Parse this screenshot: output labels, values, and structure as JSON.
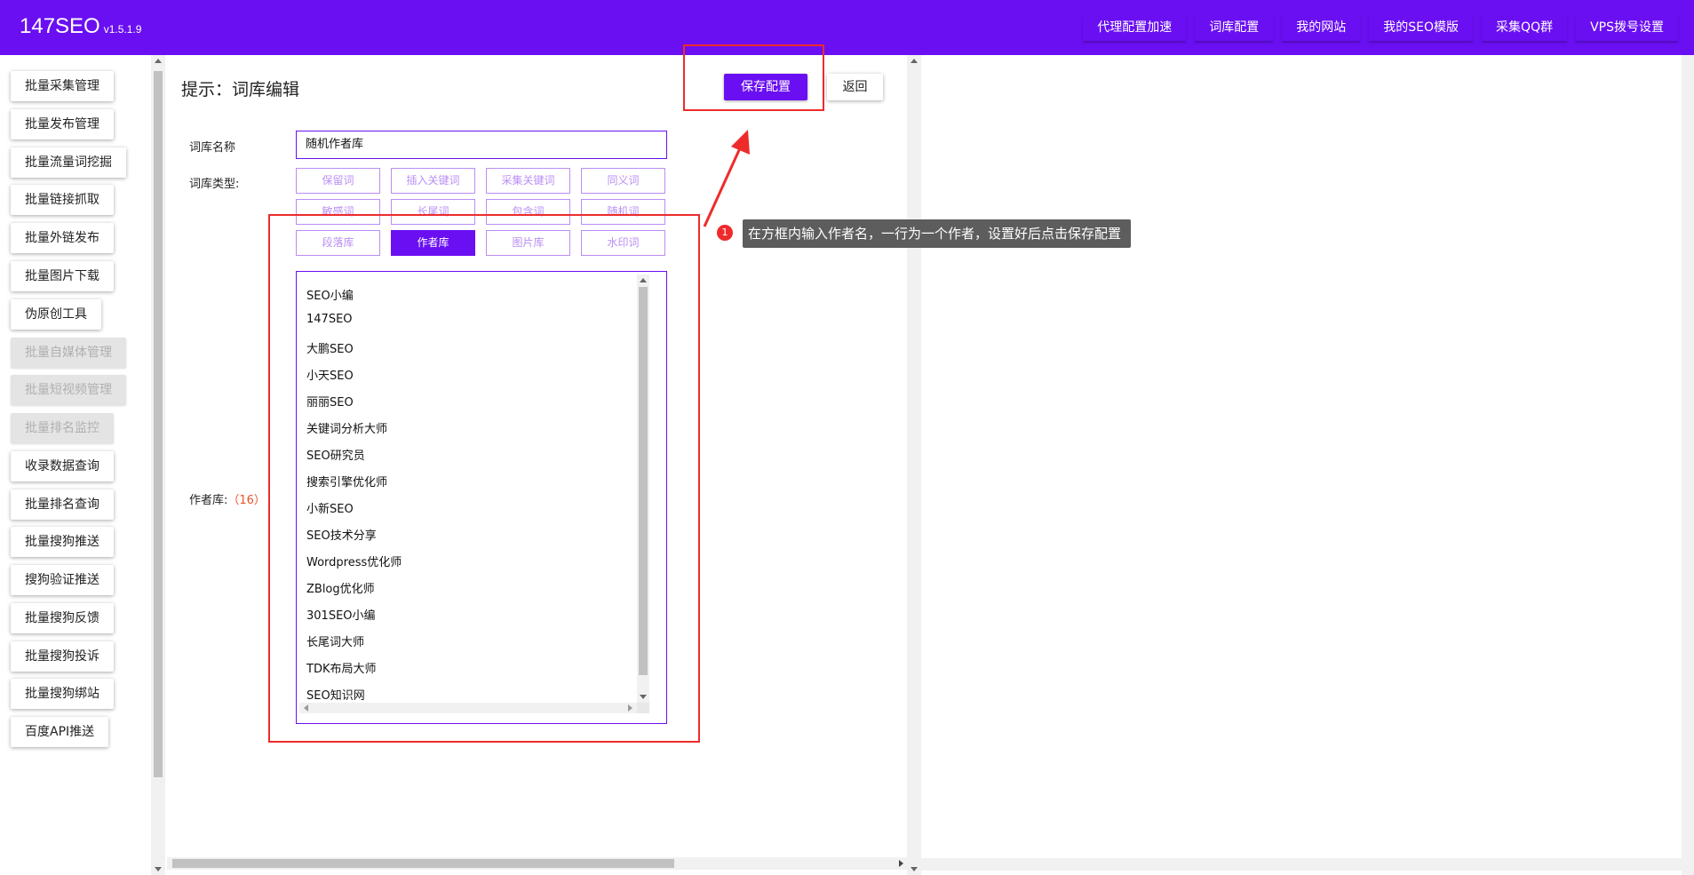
{
  "app": {
    "brand": "147SEO",
    "version": "v1.5.1.9"
  },
  "topnav": [
    {
      "label": "代理配置加速"
    },
    {
      "label": "词库配置"
    },
    {
      "label": "我的网站"
    },
    {
      "label": "我的SEO模版"
    },
    {
      "label": "采集QQ群"
    },
    {
      "label": "VPS拨号设置"
    }
  ],
  "sidebar": {
    "items": [
      {
        "label": "批量采集管理",
        "disabled": false
      },
      {
        "label": "批量发布管理",
        "disabled": false
      },
      {
        "label": "批量流量词挖掘",
        "disabled": false
      },
      {
        "label": "批量链接抓取",
        "disabled": false
      },
      {
        "label": "批量外链发布",
        "disabled": false
      },
      {
        "label": "批量图片下载",
        "disabled": false
      },
      {
        "label": "伪原创工具",
        "disabled": false
      },
      {
        "label": "批量自媒体管理",
        "disabled": true
      },
      {
        "label": "批量短视频管理",
        "disabled": true
      },
      {
        "label": "批量排名监控",
        "disabled": true
      },
      {
        "label": "收录数据查询",
        "disabled": false
      },
      {
        "label": "批量排名查询",
        "disabled": false
      },
      {
        "label": "批量搜狗推送",
        "disabled": false
      },
      {
        "label": "搜狗验证推送",
        "disabled": false
      },
      {
        "label": "批量搜狗反馈",
        "disabled": false
      },
      {
        "label": "批量搜狗投诉",
        "disabled": false
      },
      {
        "label": "批量搜狗绑站",
        "disabled": false
      },
      {
        "label": "百度API推送",
        "disabled": false
      }
    ]
  },
  "main": {
    "title": "提示：词库编辑",
    "save_label": "保存配置",
    "back_label": "返回",
    "name_label": "词库名称",
    "name_value": "随机作者库",
    "type_label": "词库类型:",
    "types": [
      {
        "label": "保留词",
        "active": false
      },
      {
        "label": "插入关键词",
        "active": false
      },
      {
        "label": "采集关键词",
        "active": false
      },
      {
        "label": "同义词",
        "active": false
      },
      {
        "label": "敏感词",
        "active": false
      },
      {
        "label": "长尾词",
        "active": false
      },
      {
        "label": "包含词",
        "active": false
      },
      {
        "label": "随机词",
        "active": false
      },
      {
        "label": "段落库",
        "active": false
      },
      {
        "label": "作者库",
        "active": true
      },
      {
        "label": "图片库",
        "active": false
      },
      {
        "label": "水印词",
        "active": false
      }
    ],
    "author_label": "作者库:",
    "author_count": "（16）",
    "authors": [
      "SEO小编",
      "147SEO",
      "大鹏SEO",
      "小天SEO",
      "丽丽SEO",
      "关键词分析大师",
      "SEO研究员",
      "搜索引擎优化师",
      "小新SEO",
      "SEO技术分享",
      "Wordpress优化师",
      "ZBlog优化师",
      "301SEO小编",
      "长尾词大师",
      "TDK布局大师",
      "SEO知识网"
    ]
  },
  "annotation": {
    "number": "1",
    "text": "在方框内输入作者名，一行为一个作者，设置好后点击保存配置",
    "color": "#ee2b2b"
  },
  "colors": {
    "brand": "#6a0ff2",
    "highlight": "#ee2b2b"
  }
}
